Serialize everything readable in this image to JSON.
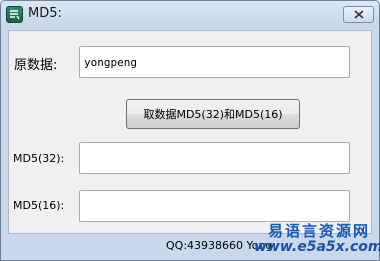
{
  "window": {
    "title": "MD5:",
    "close_symbol": "close-icon",
    "app_icon": "app-logo-icon"
  },
  "form": {
    "source_label": "原数据:",
    "source_value": "yongpeng",
    "action_label": "取数据MD5(32)和MD5(16)",
    "md5_32_label": "MD5(32):",
    "md5_32_value": "",
    "md5_16_label": "MD5(16):",
    "md5_16_value": ""
  },
  "status": {
    "text": "QQ:43938660 Yong"
  },
  "watermark": {
    "line1": "易语言资源网",
    "line2": "www.e5a5x.com"
  },
  "colors": {
    "titlebar": "#c9d8ea",
    "client_bg": "#f0f0f0",
    "watermark_blue": "#1b57b8"
  }
}
